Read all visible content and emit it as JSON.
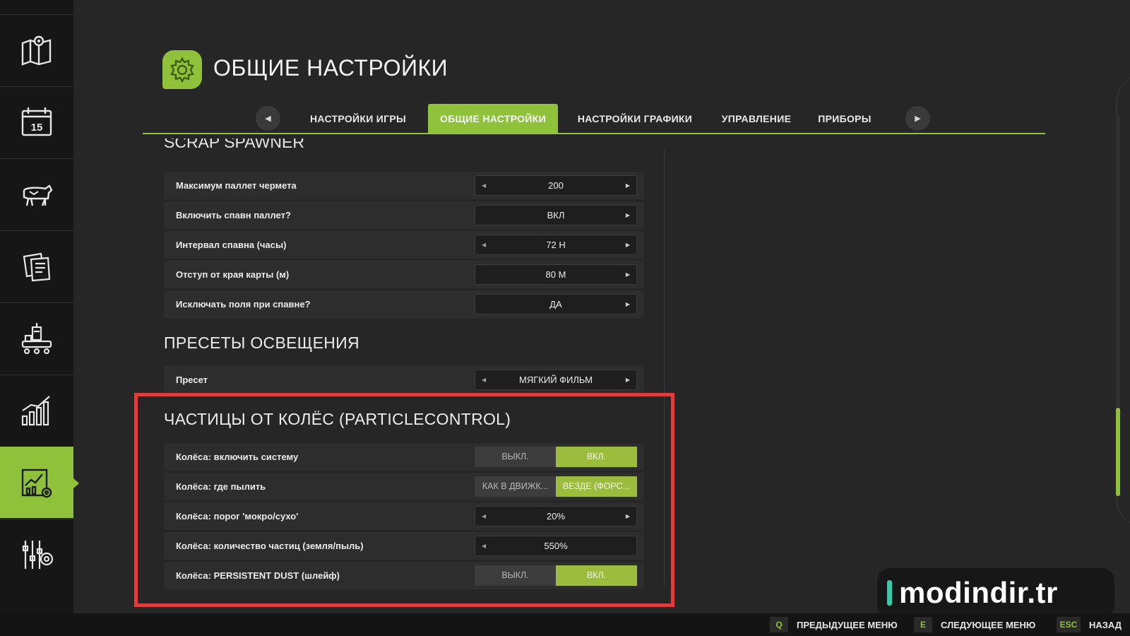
{
  "header": {
    "title": "ОБЩИЕ НАСТРОЙКИ",
    "icon": "gear-icon"
  },
  "sidebar": {
    "items": [
      {
        "icon": "map-icon"
      },
      {
        "icon": "calendar-icon",
        "day": "15"
      },
      {
        "icon": "cow-icon"
      },
      {
        "icon": "contracts-icon"
      },
      {
        "icon": "production-icon"
      },
      {
        "icon": "statistics-icon"
      },
      {
        "icon": "settings-stats-icon",
        "active": true
      },
      {
        "icon": "game-settings-icon"
      }
    ]
  },
  "tabs": {
    "prev_icon": "◀",
    "next_icon": "▶",
    "items": [
      {
        "label": "НАСТРОЙКИ ИГРЫ"
      },
      {
        "label": "ОБЩИЕ НАСТРОЙКИ",
        "active": true
      },
      {
        "label": "НАСТРОЙКИ ГРАФИКИ"
      },
      {
        "label": "УПРАВЛЕНИЕ"
      },
      {
        "label": "ПРИБОРЫ"
      }
    ]
  },
  "sections": {
    "scrap": {
      "title": "SCRAP SPAWNER",
      "rows": [
        {
          "label": "Максимум паллет чермета",
          "value": "200"
        },
        {
          "label": "Включить спавн паллет?",
          "value": "ВКЛ"
        },
        {
          "label": "Интервал спавна (часы)",
          "value": "72 H"
        },
        {
          "label": "Отступ от края карты (м)",
          "value": "80 M"
        },
        {
          "label": "Исключать поля при спавне?",
          "value": "ДА"
        }
      ]
    },
    "lighting": {
      "title": "ПРЕСЕТЫ ОСВЕЩЕНИЯ",
      "rows": [
        {
          "label": "Пресет",
          "value": "МЯГКИЙ ФИЛЬМ"
        }
      ]
    },
    "particles": {
      "title": "ЧАСТИЦЫ ОТ КОЛЁС (PARTICLECONTROL)",
      "rows": [
        {
          "label": "Колёса: включить систему",
          "off": "ВЫКЛ.",
          "on": "ВКЛ."
        },
        {
          "label": "Колёса: где пылить",
          "off": "КАК В ДВИЖК...",
          "on": "ВЕЗДЕ (ФОРС..."
        },
        {
          "label": "Колёса: порог 'мокро/сухо'",
          "value": "20%"
        },
        {
          "label": "Колёса: количество частиц (земля/пыль)",
          "value": "550%"
        },
        {
          "label": "Колёса: PERSISTENT DUST (шлейф)",
          "off": "ВЫКЛ.",
          "on": "ВКЛ."
        }
      ]
    }
  },
  "watermark": {
    "text": "modindir.tr"
  },
  "bottom_bar": {
    "hints": [
      {
        "key": "Q",
        "label": "ПРЕДЫДУЩЕЕ МЕНЮ"
      },
      {
        "key": "E",
        "label": "СЛЕДУЮЩЕЕ МЕНЮ"
      },
      {
        "key": "ESC",
        "label": "НАЗАД"
      }
    ]
  },
  "colors": {
    "accent": "#8fc13a",
    "highlight_border": "#dc3e3e",
    "background": "#262626"
  }
}
